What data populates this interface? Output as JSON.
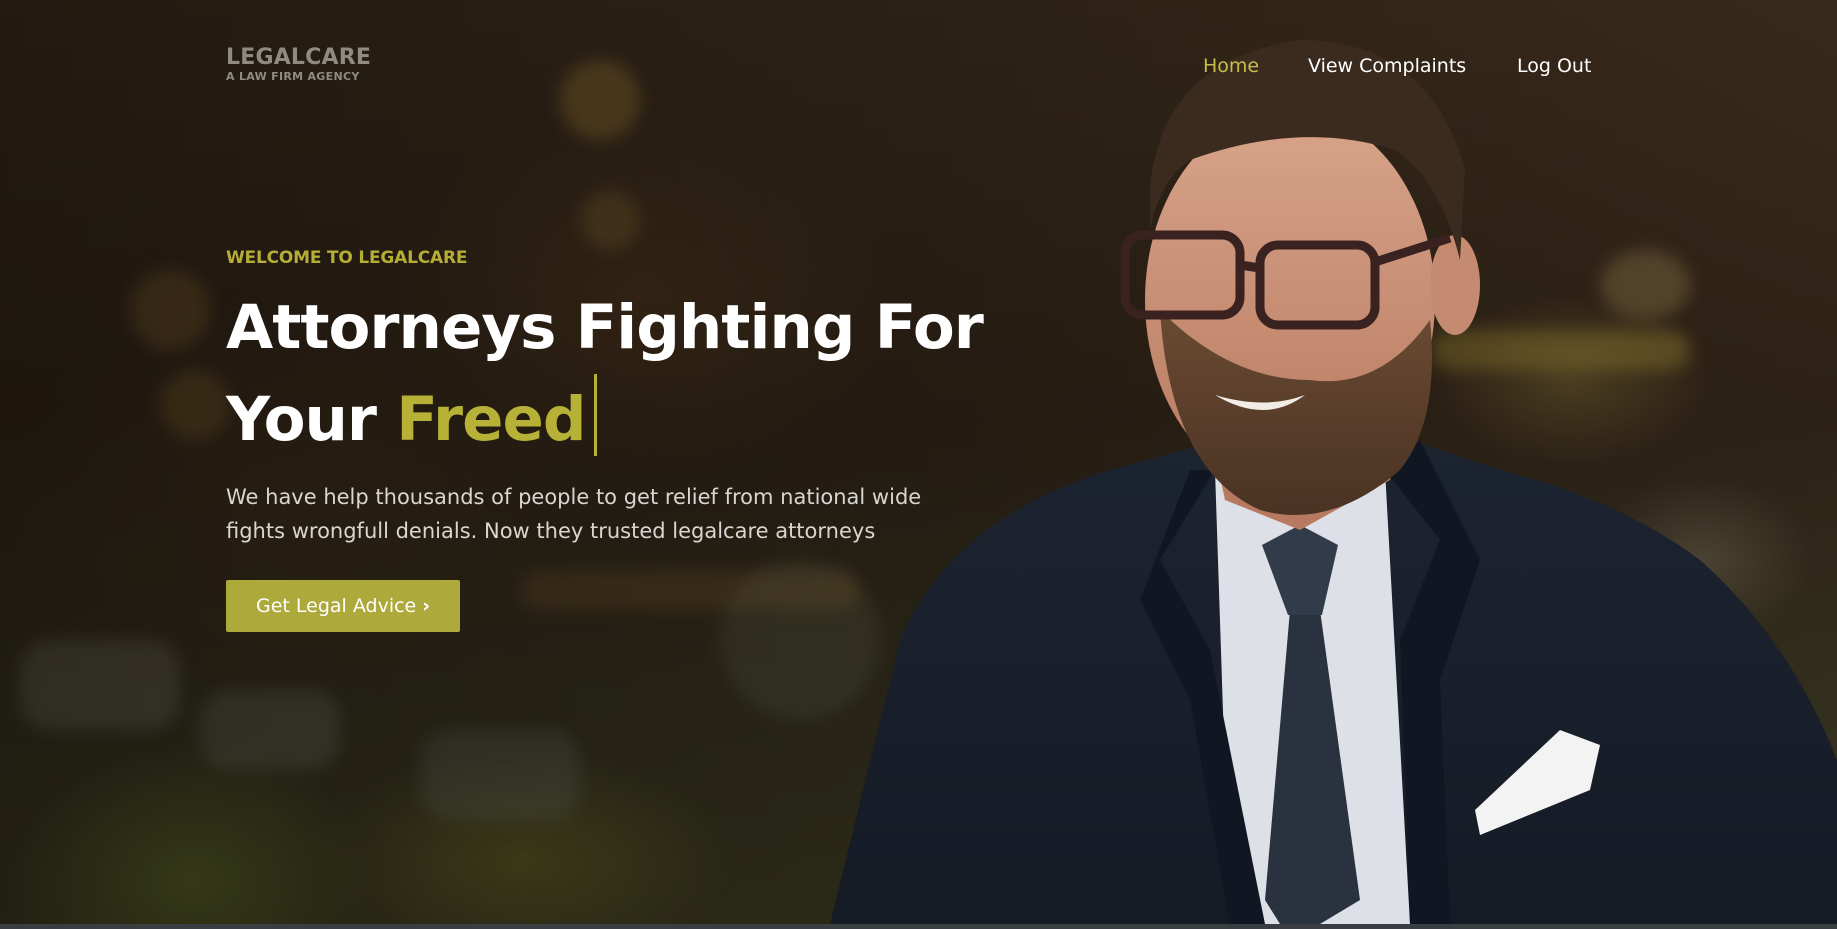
{
  "brand": {
    "name": "LEGALCARE",
    "tagline": "A LAW FIRM AGENCY"
  },
  "nav": {
    "items": [
      {
        "label": "Home",
        "active": true
      },
      {
        "label": "View Complaints",
        "active": false
      },
      {
        "label": "Log Out",
        "active": false
      }
    ]
  },
  "hero": {
    "eyebrow": "WELCOME TO LEGALCARE",
    "headline_line1": "Attorneys Fighting For",
    "headline_line2_prefix": "Your",
    "headline_line2_accent": "Freed",
    "description": "We have help thousands of people to get relief from national wide fights wrongfull denials. Now they trusted legalcare attorneys",
    "cta_label": "Get Legal Advice",
    "cta_icon": "chevron-right-icon"
  },
  "colors": {
    "accent": "#b7b138",
    "active_nav": "#c7bf4a",
    "button": "#ada93a"
  }
}
